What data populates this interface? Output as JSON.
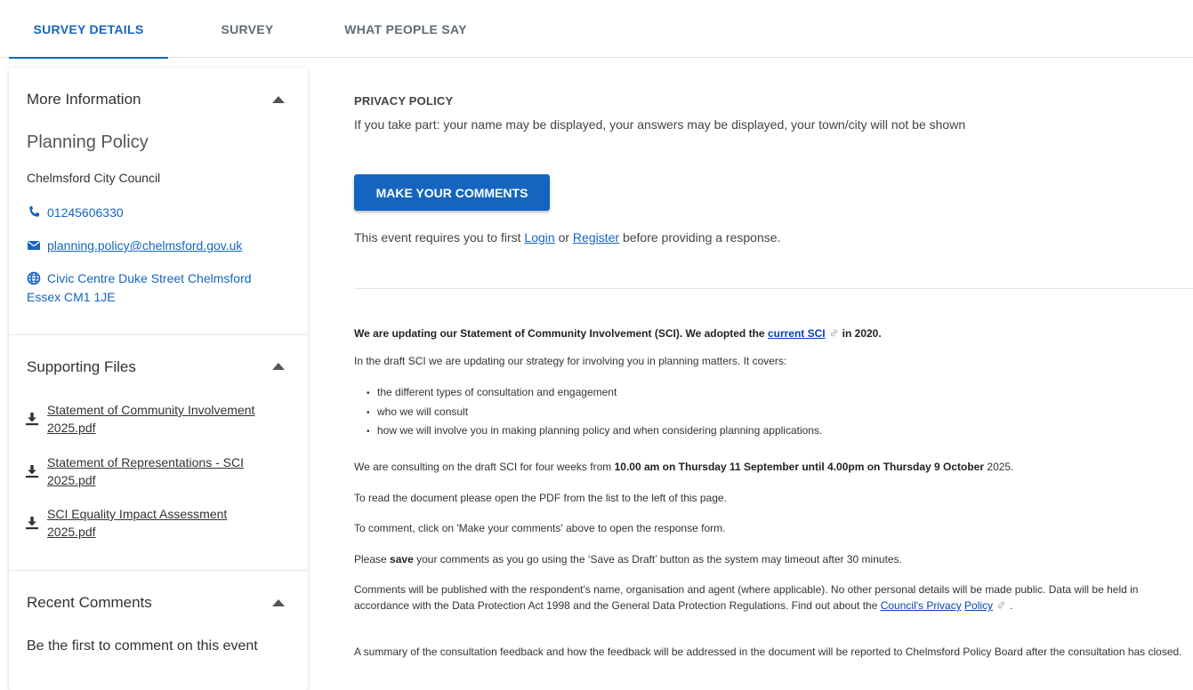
{
  "tabs": [
    {
      "label": "SURVEY DETAILS",
      "active": true
    },
    {
      "label": "SURVEY",
      "active": false
    },
    {
      "label": "WHAT PEOPLE SAY",
      "active": false
    }
  ],
  "sidebar": {
    "more_info": {
      "heading": "More Information",
      "title": "Planning Policy",
      "org": "Chelmsford City Council",
      "phone": "01245606330",
      "email": "planning.policy@chelmsford.gov.uk",
      "address_line1": "Civic Centre Duke Street Chelmsford",
      "address_line2": "Essex CM1 1JE"
    },
    "supporting_files": {
      "heading": "Supporting Files",
      "files": [
        {
          "line1": "Statement of Community Involvement",
          "line2": "2025.pdf"
        },
        {
          "line1": "Statement of Representations - SCI",
          "line2": "2025.pdf"
        },
        {
          "line1": "SCI Equality Impact Assessment",
          "line2": "2025.pdf"
        }
      ]
    },
    "recent_comments": {
      "heading": "Recent Comments",
      "empty_text": "Be the first to comment on this event"
    }
  },
  "main": {
    "privacy_heading": "PRIVACY POLICY",
    "privacy_text": "If you take part: your name may be displayed, your answers may be displayed, your town/city will not be shown",
    "make_comments_label": "MAKE YOUR COMMENTS",
    "requires_prefix": "This event requires you to first",
    "login_label": "Login",
    "or_text": "or",
    "register_label": "Register",
    "requires_suffix": "before providing a response.",
    "intro_bold": "We are updating our Statement of Community Involvement (SCI). We adopted the",
    "intro_link": "current SCI",
    "intro_end": "in 2020.",
    "draft_text": "In the draft SCI we are updating our strategy for involving you in planning matters.  It covers:",
    "bullets": [
      "the different types of consultation and engagement",
      "who we will consult",
      "how we will involve you in making planning policy and when considering planning applications."
    ],
    "consult_prefix": "We are consulting on the draft SCI for four weeks from",
    "consult_bold": "10.00 am on Thursday 11 September until 4.00pm on Thursday 9 October",
    "consult_suffix": "2025.",
    "read_text": "To read the document please open the PDF from the list to the left of this page.",
    "comment_text": "To comment, click on 'Make your comments' above to open the response form.",
    "save_prefix": "Please",
    "save_bold": "save",
    "save_suffix": "your comments as you go using the ‘Save as Draft’ button as the system may timeout after 30 minutes.",
    "published_text": "Comments will be published with the respondent's name, organisation and agent (where applicable). No other personal details will be made public. Data will be held in accordance with the Data Protection Act 1998 and the General Data Protection Regulations. Find out about the",
    "privacy_link_1": "Council's Privacy",
    "privacy_link_2": "Policy",
    "period": ".",
    "summary_text": "A summary of the consultation feedback and how the feedback will be addressed in the document will be reported to Chelmsford Policy Board after the consultation has closed."
  },
  "icons": {
    "phone": "phone-icon",
    "email": "envelope-icon",
    "address": "globe-icon",
    "download": "download-icon",
    "collapse": "caret-up-icon",
    "external": "external-link-icon"
  },
  "colors": {
    "accent": "#1565c0",
    "link": "#0645ad"
  }
}
